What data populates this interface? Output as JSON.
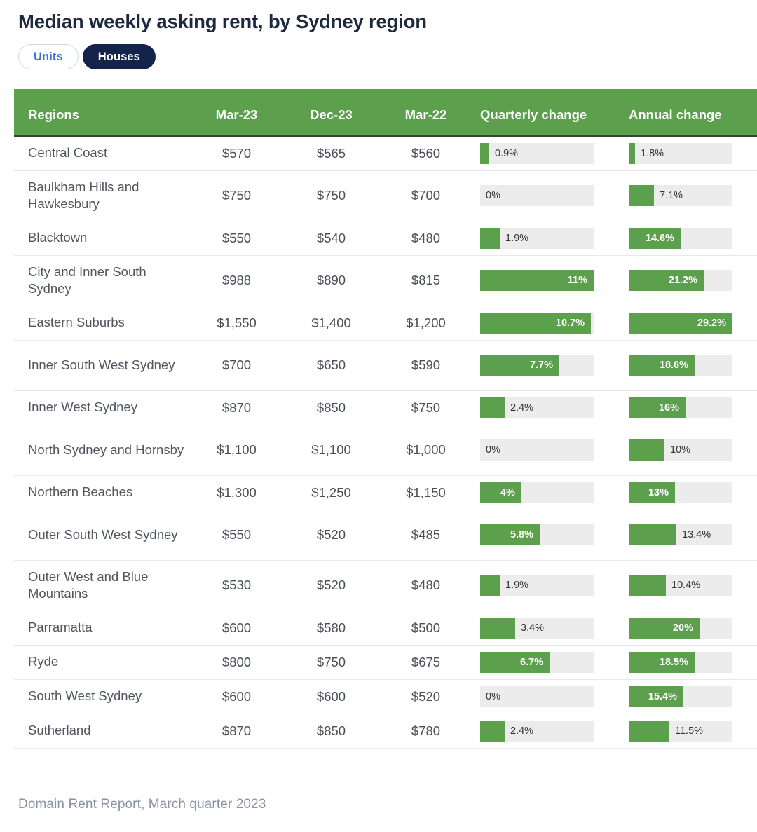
{
  "header": {
    "title": "Median weekly asking rent, by Sydney region"
  },
  "toggles": {
    "units_label": "Units",
    "houses_label": "Houses",
    "selected": "Houses"
  },
  "footer": {
    "source": "Domain Rent Report, March quarter 2023"
  },
  "colors": {
    "green": "#5ca04e",
    "track": "#ececec",
    "navy": "#13234a",
    "blue_text": "#3f6fd8",
    "footer_text": "#8a93a5"
  },
  "chart_data": {
    "type": "table",
    "title": "Median weekly asking rent, by Sydney region",
    "subtitle": "Houses",
    "source": "Domain Rent Report, March quarter 2023",
    "columns": [
      "Regions",
      "Mar-23",
      "Dec-23",
      "Mar-22",
      "Quarterly change",
      "Annual change"
    ],
    "quarterly_axis_max_pct": 11,
    "annual_axis_max_pct": 29.2,
    "rows": [
      {
        "region": "Central Coast",
        "mar23": "$570",
        "dec23": "$565",
        "mar22": "$560",
        "quarterly_label": "0.9%",
        "quarterly_value": 0.9,
        "quarterly_inside": false,
        "annual_label": "1.8%",
        "annual_value": 1.8,
        "annual_inside": false,
        "tall": false
      },
      {
        "region": "Baulkham Hills and Hawkesbury",
        "mar23": "$750",
        "dec23": "$750",
        "mar22": "$700",
        "quarterly_label": "0%",
        "quarterly_value": 0,
        "quarterly_inside": false,
        "annual_label": "7.1%",
        "annual_value": 7.1,
        "annual_inside": false,
        "tall": true
      },
      {
        "region": "Blacktown",
        "mar23": "$550",
        "dec23": "$540",
        "mar22": "$480",
        "quarterly_label": "1.9%",
        "quarterly_value": 1.9,
        "quarterly_inside": false,
        "annual_label": "14.6%",
        "annual_value": 14.6,
        "annual_inside": true,
        "tall": false
      },
      {
        "region": "City and Inner South Sydney",
        "mar23": "$988",
        "dec23": "$890",
        "mar22": "$815",
        "quarterly_label": "11%",
        "quarterly_value": 11,
        "quarterly_inside": true,
        "annual_label": "21.2%",
        "annual_value": 21.2,
        "annual_inside": true,
        "tall": true
      },
      {
        "region": "Eastern Suburbs",
        "mar23": "$1,550",
        "dec23": "$1,400",
        "mar22": "$1,200",
        "quarterly_label": "10.7%",
        "quarterly_value": 10.7,
        "quarterly_inside": true,
        "annual_label": "29.2%",
        "annual_value": 29.2,
        "annual_inside": true,
        "tall": false
      },
      {
        "region": "Inner South West Sydney",
        "mar23": "$700",
        "dec23": "$650",
        "mar22": "$590",
        "quarterly_label": "7.7%",
        "quarterly_value": 7.7,
        "quarterly_inside": true,
        "annual_label": "18.6%",
        "annual_value": 18.6,
        "annual_inside": true,
        "tall": true
      },
      {
        "region": "Inner West Sydney",
        "mar23": "$870",
        "dec23": "$850",
        "mar22": "$750",
        "quarterly_label": "2.4%",
        "quarterly_value": 2.4,
        "quarterly_inside": false,
        "annual_label": "16%",
        "annual_value": 16,
        "annual_inside": true,
        "tall": false
      },
      {
        "region": "North Sydney and Hornsby",
        "mar23": "$1,100",
        "dec23": "$1,100",
        "mar22": "$1,000",
        "quarterly_label": "0%",
        "quarterly_value": 0,
        "quarterly_inside": false,
        "annual_label": "10%",
        "annual_value": 10,
        "annual_inside": false,
        "tall": true
      },
      {
        "region": "Northern Beaches",
        "mar23": "$1,300",
        "dec23": "$1,250",
        "mar22": "$1,150",
        "quarterly_label": "4%",
        "quarterly_value": 4,
        "quarterly_inside": true,
        "annual_label": "13%",
        "annual_value": 13,
        "annual_inside": true,
        "tall": false
      },
      {
        "region": "Outer South West Sydney",
        "mar23": "$550",
        "dec23": "$520",
        "mar22": "$485",
        "quarterly_label": "5.8%",
        "quarterly_value": 5.8,
        "quarterly_inside": true,
        "annual_label": "13.4%",
        "annual_value": 13.4,
        "annual_inside": false,
        "tall": true
      },
      {
        "region": "Outer West and Blue Mountains",
        "mar23": "$530",
        "dec23": "$520",
        "mar22": "$480",
        "quarterly_label": "1.9%",
        "quarterly_value": 1.9,
        "quarterly_inside": false,
        "annual_label": "10.4%",
        "annual_value": 10.4,
        "annual_inside": false,
        "tall": true
      },
      {
        "region": "Parramatta",
        "mar23": "$600",
        "dec23": "$580",
        "mar22": "$500",
        "quarterly_label": "3.4%",
        "quarterly_value": 3.4,
        "quarterly_inside": false,
        "annual_label": "20%",
        "annual_value": 20,
        "annual_inside": true,
        "tall": false
      },
      {
        "region": "Ryde",
        "mar23": "$800",
        "dec23": "$750",
        "mar22": "$675",
        "quarterly_label": "6.7%",
        "quarterly_value": 6.7,
        "quarterly_inside": true,
        "annual_label": "18.5%",
        "annual_value": 18.5,
        "annual_inside": true,
        "tall": false
      },
      {
        "region": "South West Sydney",
        "mar23": "$600",
        "dec23": "$600",
        "mar22": "$520",
        "quarterly_label": "0%",
        "quarterly_value": 0,
        "quarterly_inside": false,
        "annual_label": "15.4%",
        "annual_value": 15.4,
        "annual_inside": true,
        "tall": false
      },
      {
        "region": "Sutherland",
        "mar23": "$870",
        "dec23": "$850",
        "mar22": "$780",
        "quarterly_label": "2.4%",
        "quarterly_value": 2.4,
        "quarterly_inside": false,
        "annual_label": "11.5%",
        "annual_value": 11.5,
        "annual_inside": false,
        "tall": false
      }
    ]
  }
}
